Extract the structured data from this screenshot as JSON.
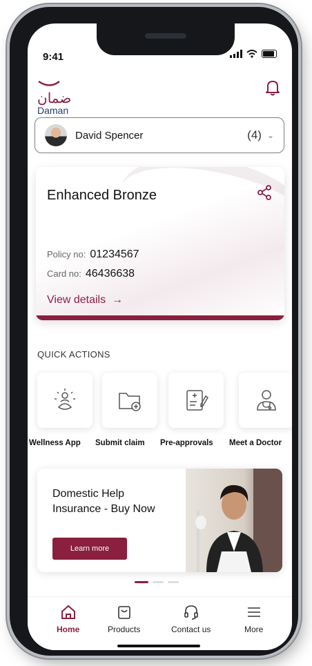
{
  "status": {
    "time": "9:41"
  },
  "brand": {
    "arabic": "ضمان",
    "english": "Daman"
  },
  "member": {
    "name": "David Spencer",
    "count": "(4)"
  },
  "policy": {
    "plan": "Enhanced Bronze",
    "policy_label": "Policy no:",
    "policy_no": "01234567",
    "card_label": "Card no:",
    "card_no": "46436638",
    "view_details": "View details"
  },
  "quick_actions": {
    "title": "QUICK ACTIONS",
    "items": [
      {
        "label": "Wellness App",
        "icon": "wellness-icon"
      },
      {
        "label": "Submit claim",
        "icon": "folder-add-icon"
      },
      {
        "label": "Pre-approvals",
        "icon": "medical-form-icon"
      },
      {
        "label": "Meet a Doctor",
        "icon": "doctor-icon"
      }
    ]
  },
  "promo": {
    "headline": "Domestic Help Insurance - Buy Now",
    "button": "Learn more"
  },
  "carousel": {
    "total": 3,
    "active": 0
  },
  "tabs": [
    {
      "label": "Home",
      "icon": "home-icon",
      "active": true
    },
    {
      "label": "Products",
      "icon": "bag-icon",
      "active": false
    },
    {
      "label": "Contact us",
      "icon": "headset-icon",
      "active": false
    },
    {
      "label": "More",
      "icon": "menu-icon",
      "active": false
    }
  ],
  "colors": {
    "brand": "#8a1f3f",
    "logo_blue": "#1e3c78"
  }
}
